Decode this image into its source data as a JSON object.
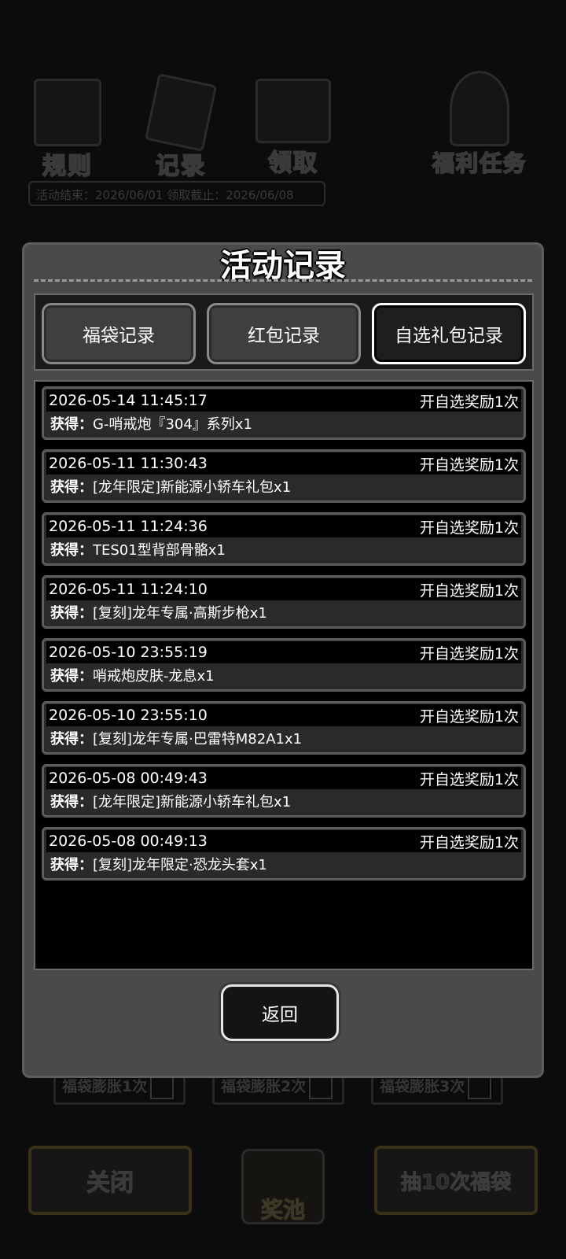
{
  "background": {
    "icons": [
      {
        "label": "规则",
        "icon": "book-icon"
      },
      {
        "label": "记录",
        "icon": "clipboard-icon"
      },
      {
        "label": "领取",
        "icon": "gift-box-icon"
      },
      {
        "label": "福利任务",
        "icon": "target-icon"
      }
    ],
    "dates_text": "活动结束：2026/06/01  领取截止：2026/06/08",
    "inflate_buttons": [
      "福袋膨胀1次",
      "福袋膨胀2次",
      "福袋膨胀3次"
    ],
    "close_button": "关闭",
    "pool_label": "奖池",
    "draw10_button": "抽10次福袋"
  },
  "modal": {
    "title": "活动记录",
    "tabs": [
      {
        "label": "福袋记录",
        "active": false
      },
      {
        "label": "红包记录",
        "active": false
      },
      {
        "label": "自选礼包记录",
        "active": true
      }
    ],
    "obtain_label": "获得：",
    "records": [
      {
        "time": "2026-05-14 11:45:17",
        "action": "开自选奖励1次",
        "item": "G-哨戒炮『304』系列x1"
      },
      {
        "time": "2026-05-11 11:30:43",
        "action": "开自选奖励1次",
        "item": "[龙年限定]新能源小轿车礼包x1"
      },
      {
        "time": "2026-05-11 11:24:36",
        "action": "开自选奖励1次",
        "item": "TES01型背部骨骼x1"
      },
      {
        "time": "2026-05-11 11:24:10",
        "action": "开自选奖励1次",
        "item": "[复刻]龙年专属·高斯步枪x1"
      },
      {
        "time": "2026-05-10 23:55:19",
        "action": "开自选奖励1次",
        "item": "哨戒炮皮肤-龙息x1"
      },
      {
        "time": "2026-05-10 23:55:10",
        "action": "开自选奖励1次",
        "item": "[复刻]龙年专属·巴雷特M82A1x1"
      },
      {
        "time": "2026-05-08 00:49:43",
        "action": "开自选奖励1次",
        "item": "[龙年限定]新能源小轿车礼包x1"
      },
      {
        "time": "2026-05-08 00:49:13",
        "action": "开自选奖励1次",
        "item": "[复刻]龙年限定·恐龙头套x1"
      }
    ],
    "back_button": "返回"
  }
}
